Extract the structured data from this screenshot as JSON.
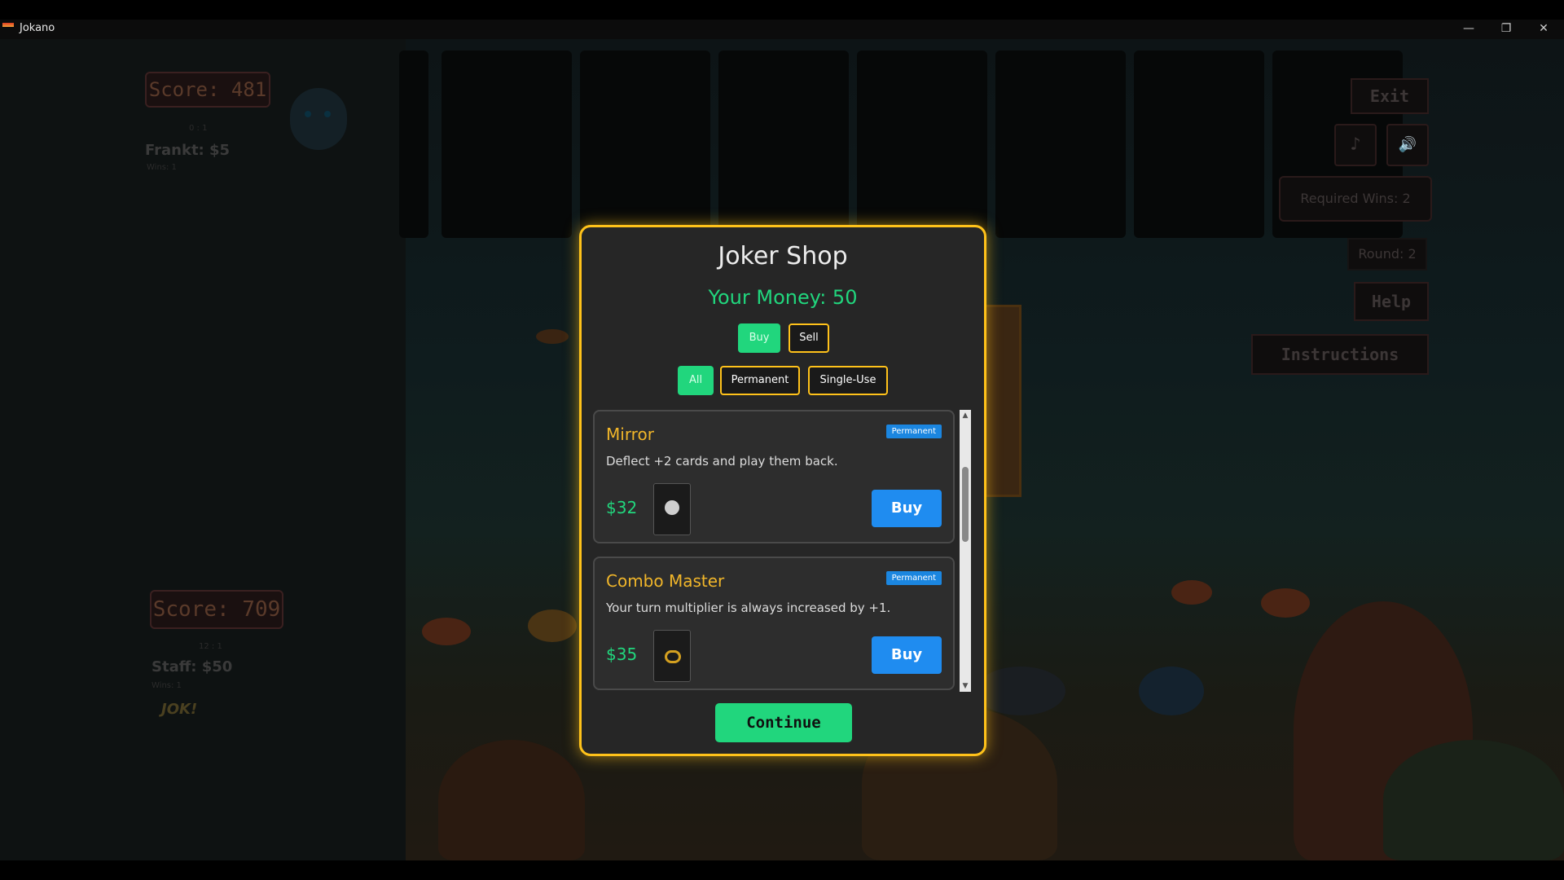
{
  "window": {
    "title": "Jokano",
    "minimize": "—",
    "restore": "❐",
    "close": "✕"
  },
  "opponent": {
    "score": "Score: 481",
    "record": "0 : 1",
    "name": "Frankt: $5",
    "wins": "Wins: 1"
  },
  "player": {
    "score": "Score: 709",
    "record": "12 : 1",
    "name": "Staff: $50",
    "wins": "Wins: 1",
    "tag": "JOK!"
  },
  "hud": {
    "exit": "Exit",
    "music_icon": "♪",
    "sound_icon": "🔊",
    "required_wins": "Required Wins: 2",
    "round": "Round: 2",
    "help": "Help",
    "instructions": "Instructions"
  },
  "shop": {
    "title": "Joker Shop",
    "money": "Your Money: 50",
    "mode_buy": "Buy",
    "mode_sell": "Sell",
    "filter_all": "All",
    "filter_permanent": "Permanent",
    "filter_single": "Single-Use",
    "items": [
      {
        "name": "Mirror",
        "badge": "Permanent",
        "description": "Deflect +2 cards and play them back.",
        "price": "$32",
        "button": "Buy"
      },
      {
        "name": "Combo Master",
        "badge": "Permanent",
        "description": "Your turn multiplier is always increased by +1.",
        "price": "$35",
        "button": "Buy"
      }
    ],
    "scroll_up": "▲",
    "scroll_down": "▼",
    "continue": "Continue"
  },
  "colors": {
    "accent_gold": "#ffc21a",
    "accent_green": "#21d67d",
    "buy_blue": "#1f8cf0",
    "item_name": "#f1b62a"
  }
}
